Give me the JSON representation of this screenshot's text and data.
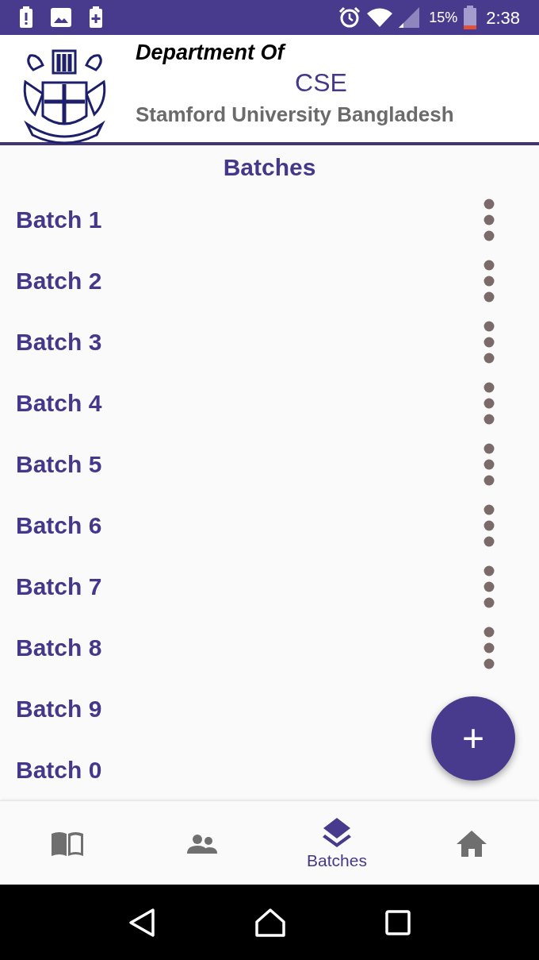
{
  "status_bar": {
    "battery": "15%",
    "time": "2:38"
  },
  "header": {
    "line_1": "Department Of",
    "line_2": "CSE",
    "line_3": "Stamford University Bangladesh"
  },
  "page_title": "Batches",
  "batches": [
    {
      "label": "Batch 1"
    },
    {
      "label": "Batch 2"
    },
    {
      "label": "Batch 3"
    },
    {
      "label": "Batch 4"
    },
    {
      "label": "Batch 5"
    },
    {
      "label": "Batch 6"
    },
    {
      "label": "Batch 7"
    },
    {
      "label": "Batch 8"
    },
    {
      "label": "Batch 9"
    },
    {
      "label": "Batch 0"
    }
  ],
  "fab": {
    "symbol": "+"
  },
  "bottom_nav": [
    {
      "kind": "book",
      "selected": false
    },
    {
      "kind": "people",
      "selected": false
    },
    {
      "kind": "layers",
      "label": "Batches",
      "selected": true
    },
    {
      "kind": "home",
      "selected": false
    }
  ]
}
